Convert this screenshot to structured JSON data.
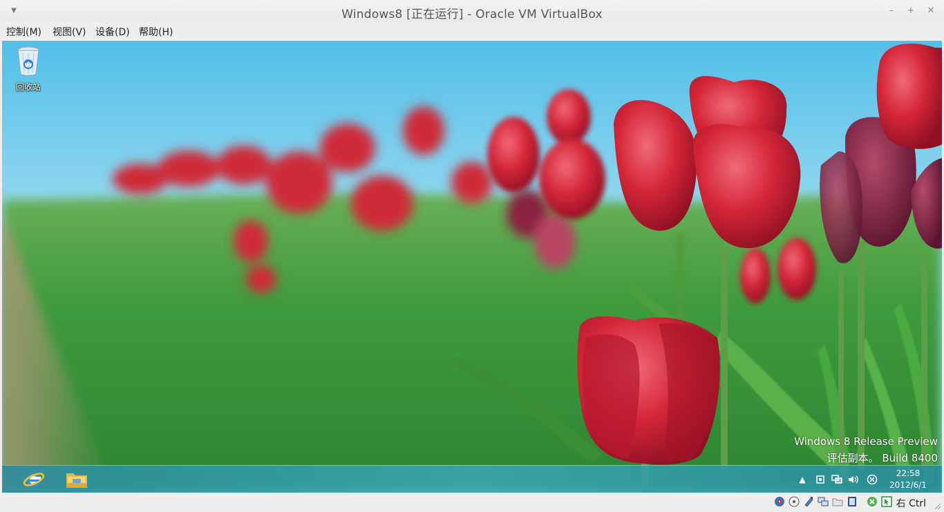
{
  "window": {
    "title": "Windows8 [正在运行] - Oracle VM VirtualBox",
    "menu_icon": "chevron-down-icon",
    "minimize_glyph": "–",
    "maximize_glyph": "+",
    "close_glyph": "✕"
  },
  "menubar": {
    "items": [
      "控制(M)",
      "视图(V)",
      "设备(D)",
      "帮助(H)"
    ]
  },
  "guest": {
    "desktop_icons": [
      {
        "label": "回收站",
        "icon": "recycle-bin-icon"
      }
    ],
    "watermark": {
      "line1": "Windows 8 Release Preview",
      "line2": "评估副本。 Build 8400"
    },
    "taskbar": {
      "apps": [
        {
          "name": "internet-explorer",
          "icon": "ie-icon"
        },
        {
          "name": "file-explorer",
          "icon": "folder-icon"
        }
      ],
      "tray_icons": [
        "chevron-up-icon",
        "action-center-flag-icon",
        "network-icon",
        "volume-icon",
        "close-circle-icon"
      ],
      "clock": {
        "time": "22:58",
        "date": "2012/6/1"
      }
    }
  },
  "statusbar": {
    "icons": [
      "hard-disk-icon",
      "optical-drive-icon",
      "usb-icon",
      "network-adapter-icon",
      "shared-folder-icon",
      "video-capture-icon",
      "virtualization-icon",
      "mouse-integration-icon"
    ],
    "host_key": "右 Ctrl"
  },
  "colors": {
    "sky": "#5cc4ea",
    "grass": "#3c9a3a",
    "tulip": "#c8202e",
    "taskbar": "#2f9cb0"
  }
}
